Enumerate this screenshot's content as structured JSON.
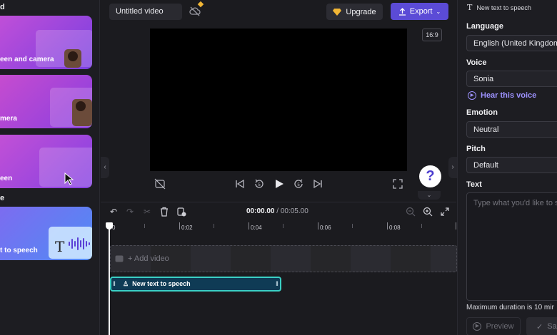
{
  "left_panel": {
    "section1_header": "d",
    "cards": [
      {
        "label": "een and camera"
      },
      {
        "label": "mera"
      },
      {
        "label": "een"
      },
      {
        "label": "t to speech"
      }
    ],
    "section2_header": "e"
  },
  "topbar": {
    "title_value": "Untitled video",
    "upgrade_label": "Upgrade",
    "export_label": "Export"
  },
  "preview": {
    "aspect_ratio": "16:9",
    "help_glyph": "?"
  },
  "timeline": {
    "current_time": "00:00.00",
    "separator": " / ",
    "total_time": "00:05.00",
    "ruler_labels": [
      "0",
      "0:02",
      "0:04",
      "0:06",
      "0:08"
    ],
    "add_video_label": "+ Add video",
    "tts_clip_label": "New text to speech"
  },
  "right_panel": {
    "title": "New text to speech",
    "language_label": "Language",
    "language_value": "English (United Kingdom)",
    "voice_label": "Voice",
    "voice_value": "Sonia",
    "hear_voice_label": "Hear this voice",
    "emotion_label": "Emotion",
    "emotion_value": "Neutral",
    "pitch_label": "Pitch",
    "pitch_value": "Default",
    "text_label": "Text",
    "text_placeholder": "Type what you'd like to sa",
    "max_duration_text": "Maximum duration is 10 mir",
    "preview_label": "Preview",
    "save_label": "Sa"
  },
  "colors": {
    "accent": "#5b4bd6",
    "link": "#9d92ff",
    "clip_border": "#3ad0c5",
    "clip_fill": "#0f3b55"
  }
}
